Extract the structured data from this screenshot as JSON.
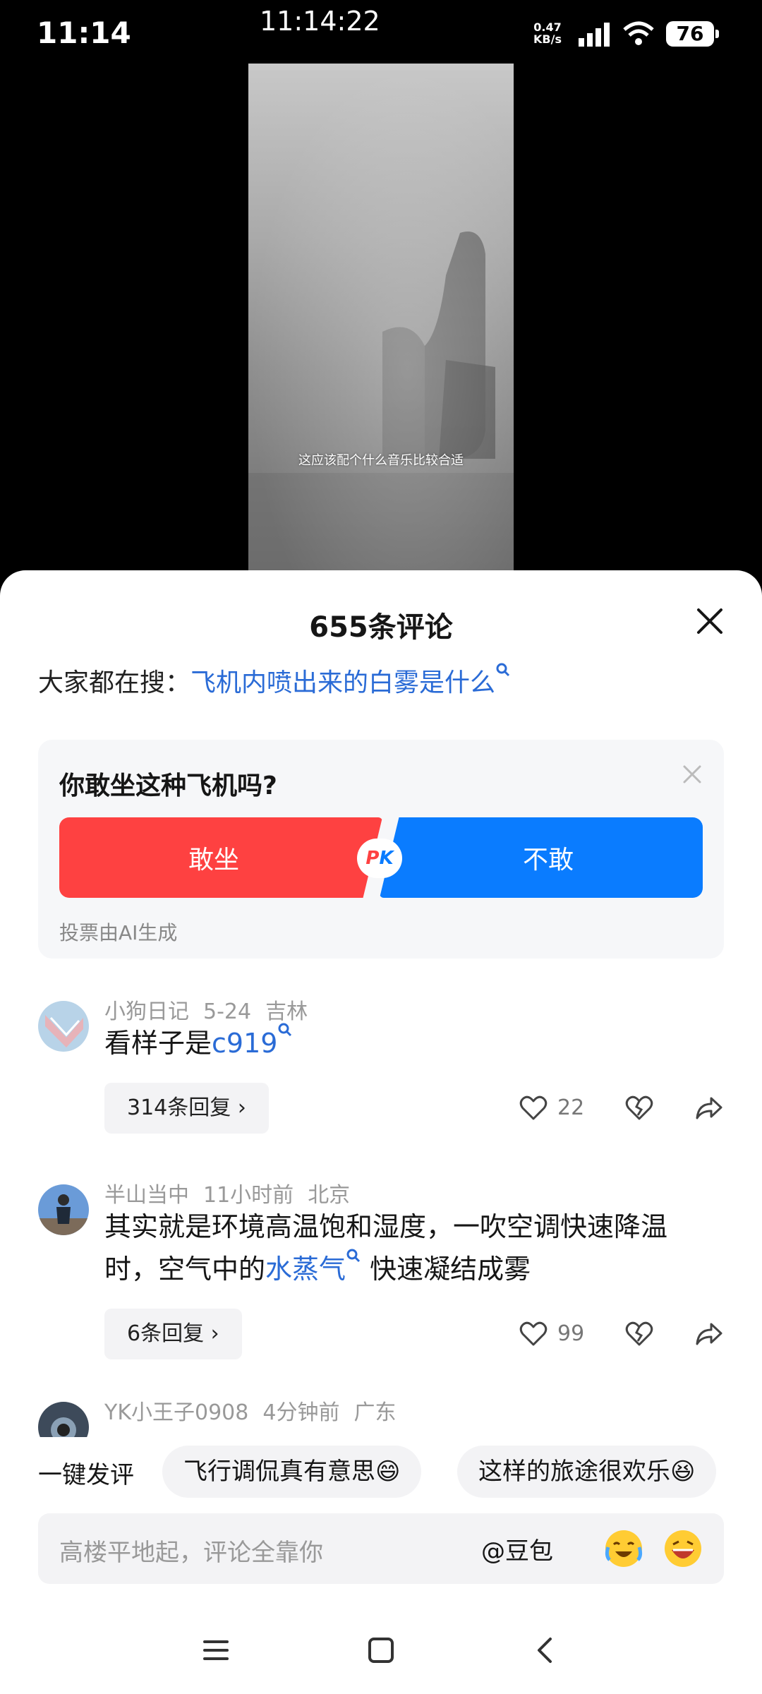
{
  "status_bar": {
    "time": "11:14",
    "center_time": "11:14:22",
    "net_speed_value": "0.47",
    "net_speed_unit": "KB/s",
    "battery": "76"
  },
  "video": {
    "subtitle": "这应该配个什么音乐比较合适"
  },
  "comments_panel": {
    "title": "655条评论",
    "search_label": "大家都在搜：",
    "search_link": "飞机内喷出来的白雾是什么"
  },
  "poll": {
    "question": "你敢坐这种飞机吗?",
    "option_yes": "敢坐",
    "option_no": "不敢",
    "pk_p": "P",
    "pk_k": "K",
    "note": "投票由AI生成"
  },
  "comments": [
    {
      "user": "小狗日记",
      "time": "5-24",
      "location": "吉林",
      "text_before": "看样子是",
      "text_link": "c919",
      "text_after": "",
      "replies": "314条回复",
      "likes": "22"
    },
    {
      "user": "半山当中",
      "time": "11小时前",
      "location": "北京",
      "text_before": "其实就是环境高温饱和湿度，一吹空调快速降温时，空气中的",
      "text_link": "水蒸气",
      "text_after": " 快速凝结成雾",
      "replies": "6条回复",
      "likes": "99"
    },
    {
      "user": "YK小王子0908",
      "time": "4分钟前",
      "location": "广东"
    }
  ],
  "quick_comment": {
    "label": "一键发评",
    "chips": [
      "飞行调侃真有意思😄",
      "这样的旅途很欢乐😆"
    ]
  },
  "input": {
    "placeholder": "高楼平地起，评论全靠你",
    "at_label": "@豆包"
  },
  "icons": {
    "search": "search-icon",
    "close": "close-icon",
    "like": "heart-icon",
    "dislike": "broken-heart-icon",
    "share": "share-icon",
    "menu": "menu-icon",
    "home": "home-icon",
    "back": "back-icon"
  },
  "colors": {
    "accent_link": "#2a6bd6",
    "poll_yes": "#fe4141",
    "poll_no": "#0a7cff"
  }
}
